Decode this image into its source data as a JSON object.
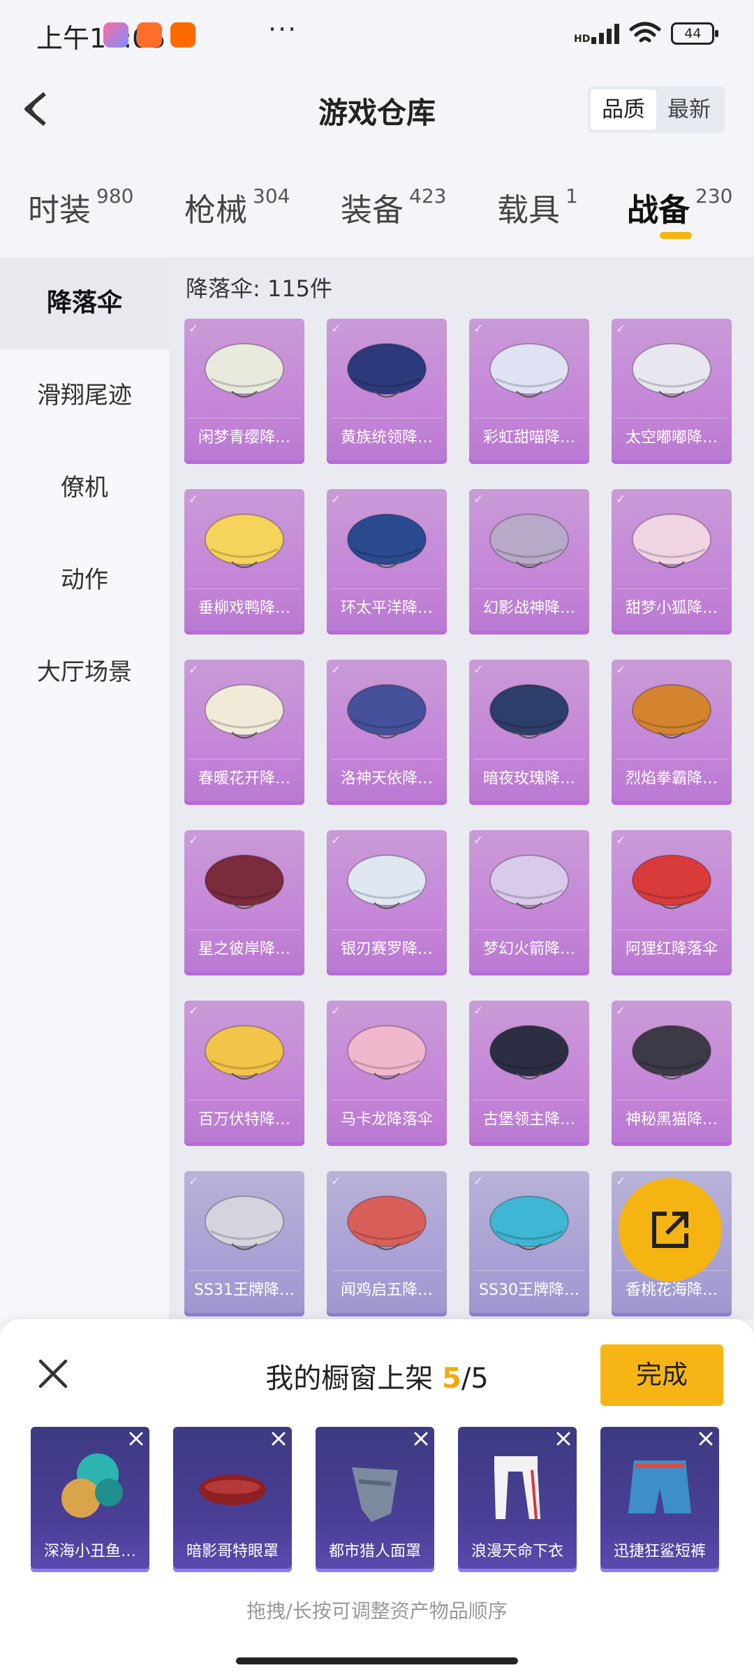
{
  "status_bar": {
    "time": "上午11:05",
    "more": "···",
    "hd": "HD",
    "battery": "44"
  },
  "header": {
    "title": "游戏仓库",
    "sort_options": [
      "品质",
      "最新"
    ],
    "selected_sort": "品质"
  },
  "categories": [
    {
      "label": "时装",
      "count": "980"
    },
    {
      "label": "枪械",
      "count": "304"
    },
    {
      "label": "装备",
      "count": "423"
    },
    {
      "label": "载具",
      "count": "1"
    },
    {
      "label": "战备",
      "count": "230"
    }
  ],
  "active_category": "战备",
  "sidebar": {
    "items": [
      "降落伞",
      "滑翔尾迹",
      "僚机",
      "动作",
      "大厅场景"
    ],
    "active": "降落伞"
  },
  "grid": {
    "count_label": "降落伞: 115件",
    "items": [
      {
        "name": "闲梦青缨降…",
        "color": "#e9eadd",
        "rarity": "purple"
      },
      {
        "name": "黄族统领降…",
        "color": "#2c3a7c",
        "rarity": "purple"
      },
      {
        "name": "彩虹甜喵降…",
        "color": "#dfe2f3",
        "rarity": "purple"
      },
      {
        "name": "太空嘟嘟降…",
        "color": "#e8e6ee",
        "rarity": "purple"
      },
      {
        "name": "垂柳戏鸭降…",
        "color": "#f6d35a",
        "rarity": "purple"
      },
      {
        "name": "环太平洋降…",
        "color": "#2a4a90",
        "rarity": "purple"
      },
      {
        "name": "幻影战神降…",
        "color": "#b9a9c9",
        "rarity": "purple"
      },
      {
        "name": "甜梦小狐降…",
        "color": "#f1d4e4",
        "rarity": "purple"
      },
      {
        "name": "春暖花开降…",
        "color": "#f1ead9",
        "rarity": "purple"
      },
      {
        "name": "洛神天依降…",
        "color": "#45519a",
        "rarity": "purple"
      },
      {
        "name": "暗夜玫瑰降…",
        "color": "#2e3e6a",
        "rarity": "purple"
      },
      {
        "name": "烈焰拳霸降…",
        "color": "#d4832e",
        "rarity": "purple"
      },
      {
        "name": "星之彼岸降…",
        "color": "#7a2b3c",
        "rarity": "purple"
      },
      {
        "name": "银刃赛罗降…",
        "color": "#dfe7f1",
        "rarity": "purple"
      },
      {
        "name": "梦幻火箭降…",
        "color": "#d9c9ea",
        "rarity": "purple"
      },
      {
        "name": "阿狸红降落伞",
        "color": "#d93b3b",
        "rarity": "purple"
      },
      {
        "name": "百万伏特降…",
        "color": "#f3c44a",
        "rarity": "purple"
      },
      {
        "name": "马卡龙降落伞",
        "color": "#f1b7cc",
        "rarity": "purple"
      },
      {
        "name": "古堡领主降…",
        "color": "#2c2f44",
        "rarity": "purple"
      },
      {
        "name": "神秘黑猫降…",
        "color": "#3c3a46",
        "rarity": "purple"
      },
      {
        "name": "SS31王牌降…",
        "color": "#d7d3de",
        "rarity": "blue"
      },
      {
        "name": "闻鸡启五降…",
        "color": "#d9605a",
        "rarity": "blue"
      },
      {
        "name": "SS30王牌降…",
        "color": "#3fb6d4",
        "rarity": "blue"
      },
      {
        "name": "香桃花海降…",
        "color": "#f2a7c2",
        "rarity": "blue"
      }
    ]
  },
  "showcase": {
    "title_prefix": "我的橱窗上架",
    "current": "5",
    "separator": "/",
    "total": "5",
    "done_label": "完成",
    "items": [
      {
        "name": "深海小丑鱼…",
        "icon": "hair-icon"
      },
      {
        "name": "暗影哥特眼罩",
        "icon": "blindfold-icon"
      },
      {
        "name": "都市猎人面罩",
        "icon": "mask-icon"
      },
      {
        "name": "浪漫天命下衣",
        "icon": "pants-icon"
      },
      {
        "name": "迅捷狂鲨短裤",
        "icon": "shorts-icon"
      }
    ],
    "hint": "拖拽/长按可调整资产物品顺序"
  }
}
